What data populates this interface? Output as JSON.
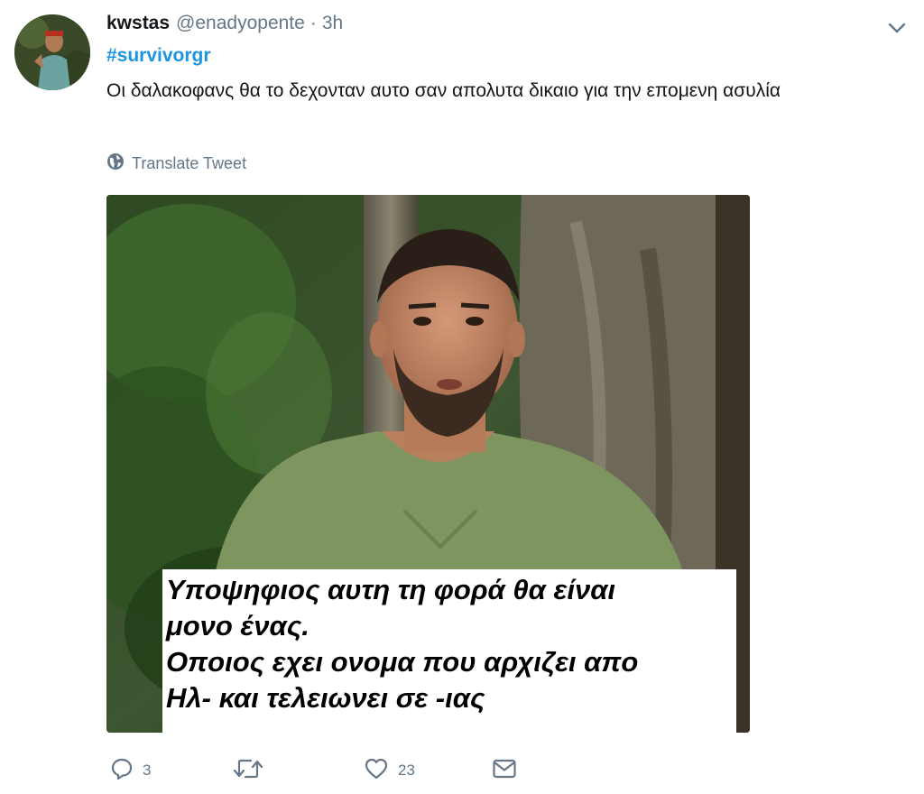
{
  "tweet": {
    "author_name": "kwstas",
    "author_handle": "@enadyopente",
    "separator": "·",
    "time": "3h",
    "hashtag": "#survivorgr",
    "text": "Οι δαλακοφανς θα το δεχονταν αυτο σαν απολυτα δικαιο για την επομενη ασυλία",
    "translate_label": "Translate Tweet"
  },
  "media": {
    "caption_lines": [
      "Υποψηφιος αυτη τη φορά θα είναι",
      "μονο ένας.",
      "Οποιος εχει ονομα που αρχιζει απο",
      "Ηλ- και τελειωνει σε -ιας"
    ]
  },
  "actions": {
    "reply_count": "3",
    "retweet_count": "",
    "like_count": "23"
  },
  "icons": {
    "reply": "reply-icon",
    "retweet": "retweet-icon",
    "like": "heart-icon",
    "dm": "envelope-icon",
    "globe": "globe-icon",
    "menu": "chevron-down-icon"
  },
  "colors": {
    "link": "#1b95e0",
    "secondary_text": "#657786",
    "primary_text": "#14171a"
  }
}
